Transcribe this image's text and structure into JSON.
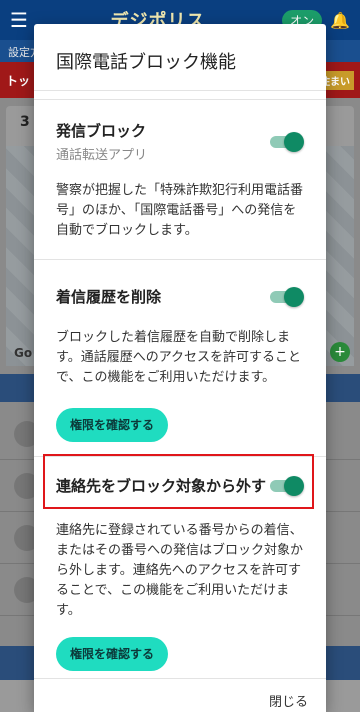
{
  "dialog": {
    "title": "国際電話ブロック機能",
    "close_label": "閉じる",
    "items": [
      {
        "title": "発信ブロック",
        "subtitle": "通話転送アプリ",
        "description": "警察が把握した「特殊詐欺犯行利用電話番号」のほか、「国際電話番号」への発信を自動でブロックします。",
        "toggle_on": true
      },
      {
        "title": "着信履歴を削除",
        "description": "ブロックした着信履歴を自動で削除します。通話履歴へのアクセスを許可することで、この機能をご利用いただけます。",
        "button_label": "権限を確認する",
        "toggle_on": true
      },
      {
        "title": "連絡先をブロック対象から外す",
        "description": "連絡先に登録されている番号からの着信、またはその番号への発信はブロック対象から外します。連絡先へのアクセスを許可することで、この機能をご利用いただけます。",
        "button_label": "権限を確認する",
        "toggle_on": true
      }
    ]
  },
  "colors": {
    "toggle_on": "#0f8a64",
    "button_bg": "#1fdcc0",
    "highlight": "#e0161a",
    "app_header": "#0a3f80"
  },
  "background_app": {
    "title": "デジポリス",
    "pill": "オン",
    "blue_strip": "設定方",
    "red_banner_left": "トッ",
    "red_banner_right": "住まい",
    "card_number": "3",
    "map_credit": "Go",
    "menu_icon": "hamburger-icon",
    "bell_icon": "bell-icon"
  }
}
